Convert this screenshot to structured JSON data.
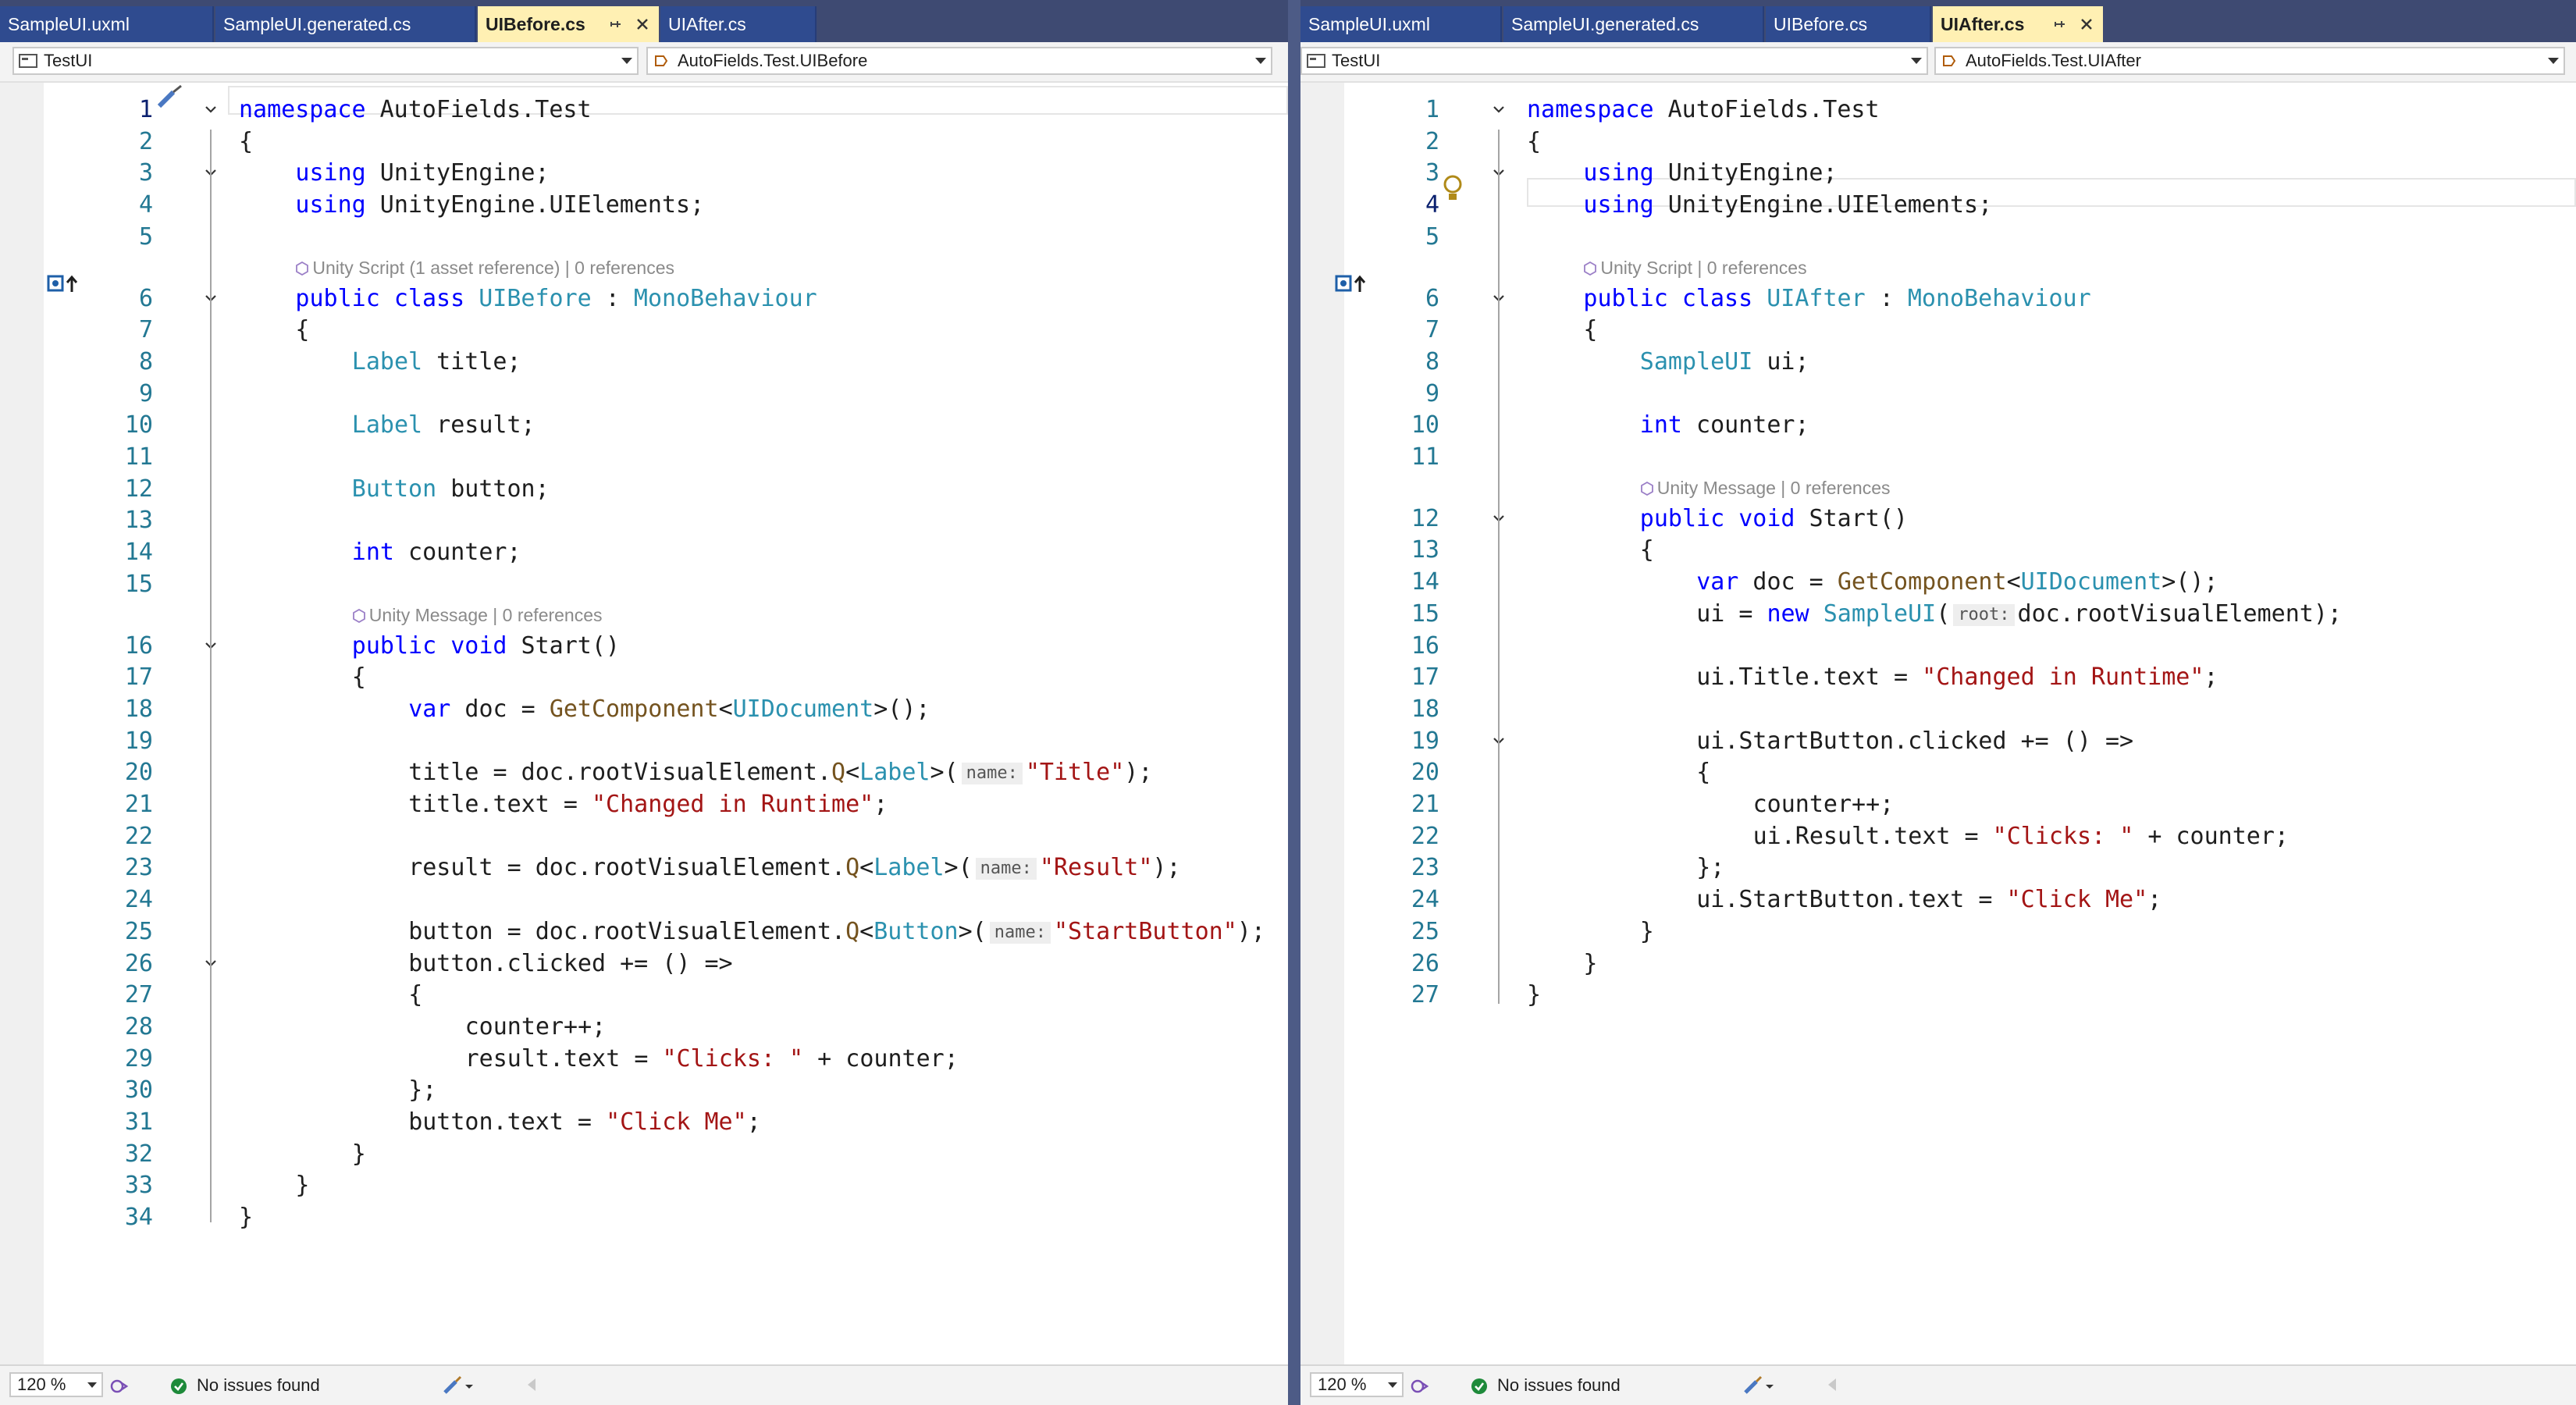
{
  "panes": [
    {
      "id": "left",
      "tabs": [
        {
          "label": "SampleUI.uxml"
        },
        {
          "label": "SampleUI.generated.cs"
        },
        {
          "label": "UIBefore.cs",
          "active": true
        },
        {
          "label": "UIAfter.cs"
        }
      ],
      "nav": {
        "project": "TestUI",
        "type": "AutoFields.Test.UIBefore"
      },
      "status": {
        "zoom": "120 %",
        "issues": "No issues found"
      },
      "lines": [
        {
          "n": "1",
          "text": "namespace AutoFields.Test"
        },
        {
          "n": "2",
          "text": "{"
        },
        {
          "n": "3",
          "text": "using UnityEngine;"
        },
        {
          "n": "4",
          "text": "using UnityEngine.UIElements;"
        },
        {
          "n": "5",
          "text": ""
        },
        {
          "n": "6",
          "text": "public class UIBefore : MonoBehaviour"
        },
        {
          "n": "7",
          "text": "{"
        },
        {
          "n": "8",
          "text": "Label title;"
        },
        {
          "n": "9",
          "text": ""
        },
        {
          "n": "10",
          "text": "Label result;"
        },
        {
          "n": "11",
          "text": ""
        },
        {
          "n": "12",
          "text": "Button button;"
        },
        {
          "n": "13",
          "text": ""
        },
        {
          "n": "14",
          "text": "int counter;"
        },
        {
          "n": "15",
          "text": ""
        },
        {
          "n": "16",
          "text": "public void Start()"
        },
        {
          "n": "17",
          "text": "{"
        },
        {
          "n": "18",
          "text": "var doc = GetComponent<UIDocument>();"
        },
        {
          "n": "19",
          "text": ""
        },
        {
          "n": "20",
          "text": "title = doc.rootVisualElement.Q<Label>(name: \"Title\");"
        },
        {
          "n": "21",
          "text": "title.text = \"Changed in Runtime\";"
        },
        {
          "n": "22",
          "text": ""
        },
        {
          "n": "23",
          "text": "result = doc.rootVisualElement.Q<Label>(name: \"Result\");"
        },
        {
          "n": "24",
          "text": ""
        },
        {
          "n": "25",
          "text": "button = doc.rootVisualElement.Q<Button>(name: \"StartButton\");"
        },
        {
          "n": "26",
          "text": "button.clicked += () =>"
        },
        {
          "n": "27",
          "text": "{"
        },
        {
          "n": "28",
          "text": "counter++;"
        },
        {
          "n": "29",
          "text": "result.text = \"Clicks: \" + counter;"
        },
        {
          "n": "30",
          "text": "};"
        },
        {
          "n": "31",
          "text": "button.text = \"Click Me\";"
        },
        {
          "n": "32",
          "text": "}"
        },
        {
          "n": "33",
          "text": "}"
        },
        {
          "n": "34",
          "text": "}"
        }
      ],
      "lenses": [
        {
          "text": "Unity Script (1 asset reference) | 0 references"
        },
        {
          "text": "Unity Message | 0 references"
        }
      ]
    },
    {
      "id": "right",
      "tabs": [
        {
          "label": "SampleUI.uxml"
        },
        {
          "label": "SampleUI.generated.cs"
        },
        {
          "label": "UIBefore.cs"
        },
        {
          "label": "UIAfter.cs",
          "active": true
        }
      ],
      "nav": {
        "project": "TestUI",
        "type": "AutoFields.Test.UIAfter"
      },
      "status": {
        "zoom": "120 %",
        "issues": "No issues found"
      },
      "lines": [
        {
          "n": "1",
          "text": "namespace AutoFields.Test"
        },
        {
          "n": "2",
          "text": "{"
        },
        {
          "n": "3",
          "text": "using UnityEngine;"
        },
        {
          "n": "4",
          "text": "using UnityEngine.UIElements;"
        },
        {
          "n": "5",
          "text": ""
        },
        {
          "n": "6",
          "text": "public class UIAfter : MonoBehaviour"
        },
        {
          "n": "7",
          "text": "{"
        },
        {
          "n": "8",
          "text": "SampleUI ui;"
        },
        {
          "n": "9",
          "text": ""
        },
        {
          "n": "10",
          "text": "int counter;"
        },
        {
          "n": "11",
          "text": ""
        },
        {
          "n": "12",
          "text": "public void Start()"
        },
        {
          "n": "13",
          "text": "{"
        },
        {
          "n": "14",
          "text": "var doc = GetComponent<UIDocument>();"
        },
        {
          "n": "15",
          "text": "ui = new SampleUI(root: doc.rootVisualElement);"
        },
        {
          "n": "16",
          "text": ""
        },
        {
          "n": "17",
          "text": "ui.Title.text = \"Changed in Runtime\";"
        },
        {
          "n": "18",
          "text": ""
        },
        {
          "n": "19",
          "text": "ui.StartButton.clicked += () =>"
        },
        {
          "n": "20",
          "text": "{"
        },
        {
          "n": "21",
          "text": "counter++;"
        },
        {
          "n": "22",
          "text": "ui.Result.text = \"Clicks: \" + counter;"
        },
        {
          "n": "23",
          "text": "};"
        },
        {
          "n": "24",
          "text": "ui.StartButton.text = \"Click Me\";"
        },
        {
          "n": "25",
          "text": "}"
        },
        {
          "n": "26",
          "text": "}"
        },
        {
          "n": "27",
          "text": "}"
        }
      ],
      "lenses": [
        {
          "text": "Unity Script | 0 references"
        },
        {
          "text": "Unity Message | 0 references"
        }
      ]
    }
  ],
  "colors": {
    "keyword": "#0000ff",
    "type": "#2b91af",
    "string": "#a31515",
    "method": "#74531f",
    "line_number": "#237893",
    "active_tab": "#fff0b3",
    "inactive_tab": "#2f4b8f"
  }
}
